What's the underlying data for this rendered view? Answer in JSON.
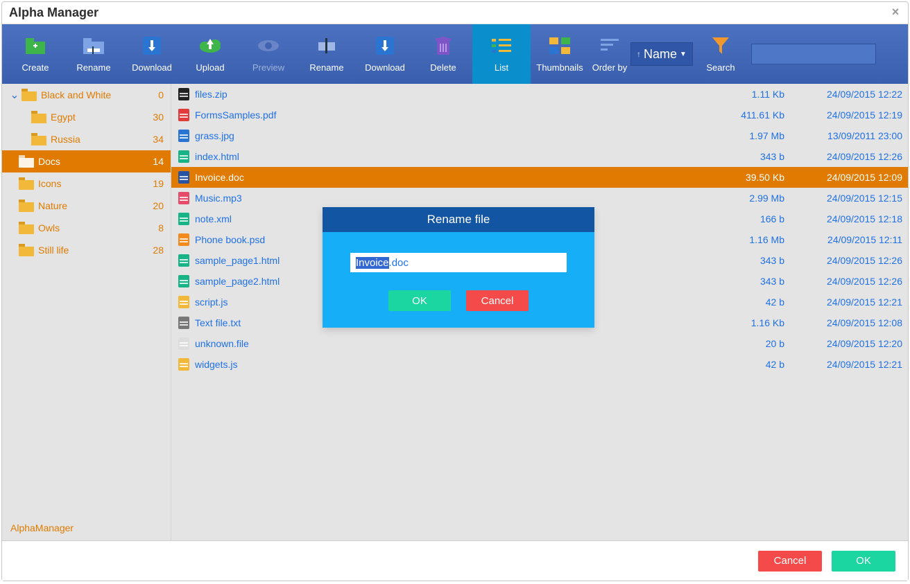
{
  "window": {
    "title": "Alpha Manager"
  },
  "toolbar": {
    "create": "Create",
    "rename": "Rename",
    "download": "Download",
    "upload": "Upload",
    "preview": "Preview",
    "rename2": "Rename",
    "download2": "Download",
    "delete": "Delete",
    "list": "List",
    "thumbnails": "Thumbnails",
    "orderby": "Order by",
    "orderby_value": "Name",
    "search": "Search"
  },
  "sidebar": {
    "brand": "AlphaManager",
    "items": [
      {
        "label": "Black and White",
        "count": "0"
      },
      {
        "label": "Egypt",
        "count": "30"
      },
      {
        "label": "Russia",
        "count": "34"
      },
      {
        "label": "Docs",
        "count": "14"
      },
      {
        "label": "Icons",
        "count": "19"
      },
      {
        "label": "Nature",
        "count": "20"
      },
      {
        "label": "Owls",
        "count": "8"
      },
      {
        "label": "Still life",
        "count": "28"
      }
    ]
  },
  "files": [
    {
      "name": "files.zip",
      "size": "1.11 Kb",
      "date": "24/09/2015 12:22",
      "type": "zip"
    },
    {
      "name": "FormsSamples.pdf",
      "size": "411.61 Kb",
      "date": "24/09/2015 12:19",
      "type": "pdf"
    },
    {
      "name": "grass.jpg",
      "size": "1.97 Mb",
      "date": "13/09/2011 23:00",
      "type": "jpg"
    },
    {
      "name": "index.html",
      "size": "343 b",
      "date": "24/09/2015 12:26",
      "type": "html"
    },
    {
      "name": "Invoice.doc",
      "size": "39.50 Kb",
      "date": "24/09/2015 12:09",
      "type": "doc",
      "selected": true
    },
    {
      "name": "Music.mp3",
      "size": "2.99 Mb",
      "date": "24/09/2015 12:15",
      "type": "mp3"
    },
    {
      "name": "note.xml",
      "size": "166 b",
      "date": "24/09/2015 12:18",
      "type": "xml"
    },
    {
      "name": "Phone book.psd",
      "size": "1.16 Mb",
      "date": "24/09/2015 12:11",
      "type": "psd"
    },
    {
      "name": "sample_page1.html",
      "size": "343 b",
      "date": "24/09/2015 12:26",
      "type": "html"
    },
    {
      "name": "sample_page2.html",
      "size": "343 b",
      "date": "24/09/2015 12:26",
      "type": "html"
    },
    {
      "name": "script.js",
      "size": "42 b",
      "date": "24/09/2015 12:21",
      "type": "js"
    },
    {
      "name": "Text file.txt",
      "size": "1.16 Kb",
      "date": "24/09/2015 12:08",
      "type": "txt"
    },
    {
      "name": "unknown.file",
      "size": "20 b",
      "date": "24/09/2015 12:20",
      "type": "unknown"
    },
    {
      "name": "widgets.js",
      "size": "42 b",
      "date": "24/09/2015 12:21",
      "type": "js"
    }
  ],
  "dialog": {
    "title": "Rename file",
    "value": "Invoice.doc",
    "ok": "OK",
    "cancel": "Cancel"
  },
  "footer": {
    "ok": "OK",
    "cancel": "Cancel"
  }
}
